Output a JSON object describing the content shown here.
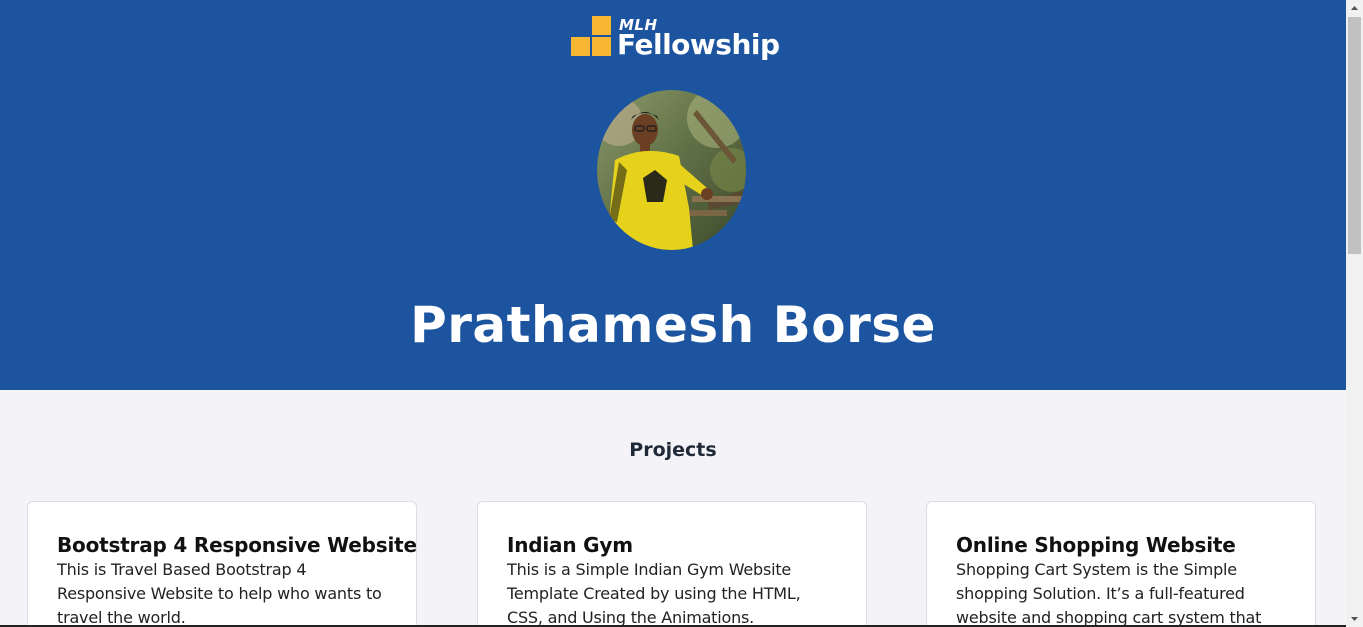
{
  "header": {
    "logo_small": "MLH",
    "logo_big": "Fellowship",
    "name": "Prathamesh Borse"
  },
  "projects": {
    "title": "Projects",
    "items": [
      {
        "title": "Bootstrap 4 Responsive Website",
        "description": "This is Travel Based Bootstrap 4 Responsive Website to help who wants to travel the world."
      },
      {
        "title": "Indian Gym",
        "description": "This is a Simple Indian Gym Website Template Created by using the HTML, CSS, and Using the Animations."
      },
      {
        "title": "Online Shopping Website",
        "description": "Shopping Cart System is the Simple shopping Solution. It’s a full-featured website and shopping cart system that"
      }
    ]
  },
  "colors": {
    "hero_bg": "#1d54a0",
    "logo_accent": "#f7b733",
    "page_bg": "#f4f3f8"
  }
}
